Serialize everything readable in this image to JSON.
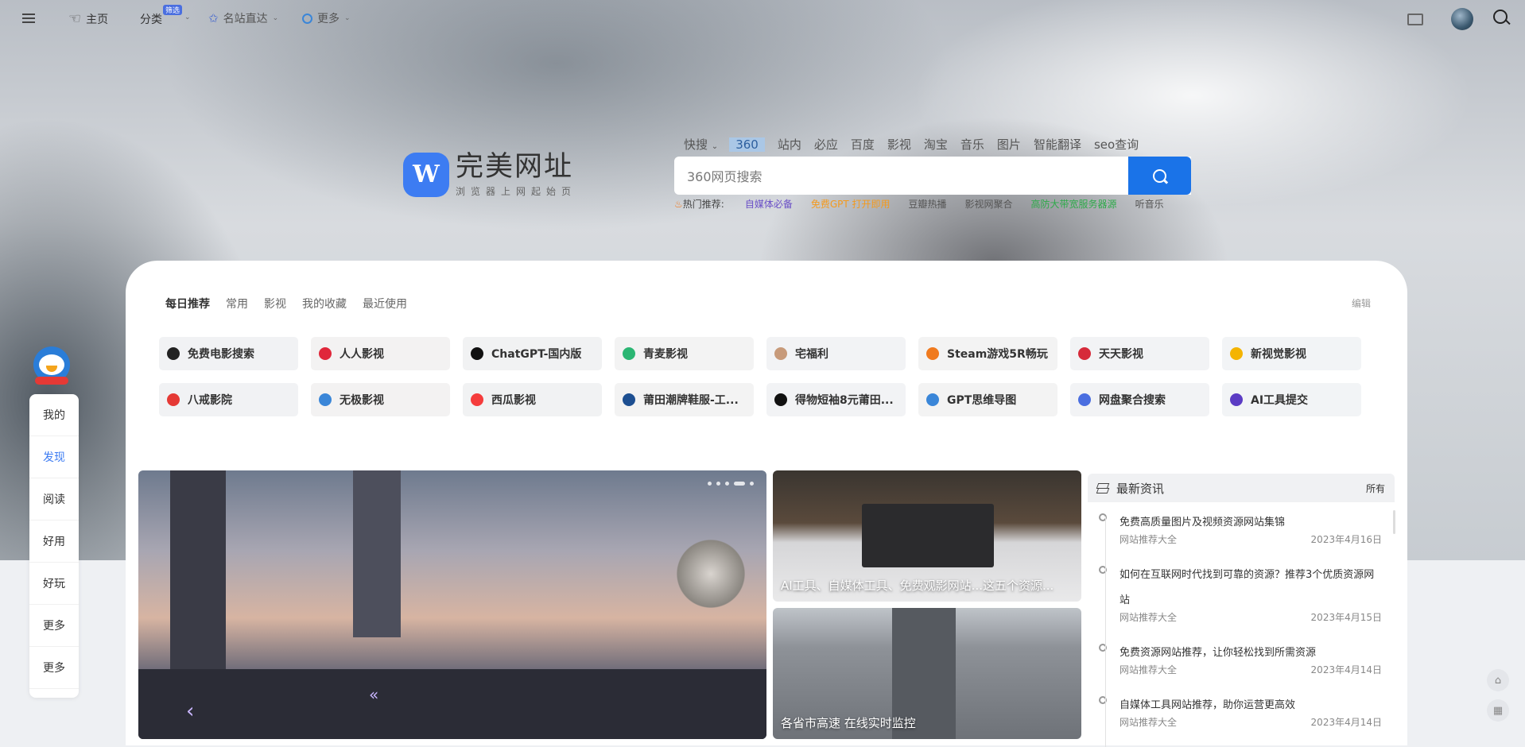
{
  "nav": {
    "home": "主页",
    "category": "分类",
    "category_badge": "筛选",
    "famous": "名站直达",
    "more": "更多"
  },
  "logo": {
    "title": "完美网址",
    "subtitle": "浏览器上网起始页",
    "mark": "W"
  },
  "search": {
    "tabs": [
      "快搜",
      "360",
      "站内",
      "必应",
      "百度",
      "影视",
      "淘宝",
      "音乐",
      "图片",
      "智能翻译",
      "seo查询"
    ],
    "active_tab": "360",
    "placeholder": "360网页搜索",
    "hot_label": "热门推荐:",
    "hot": [
      {
        "label": "自媒体必备",
        "color": "#6a4fc7"
      },
      {
        "label": "免费GPT 打开即用",
        "color": "#f39a1e"
      },
      {
        "label": "豆瓣热播",
        "color": "#555555"
      },
      {
        "label": "影视网聚合",
        "color": "#555555"
      },
      {
        "label": "高防大带宽服务器源",
        "color": "#2eaa4a"
      },
      {
        "label": "听音乐",
        "color": "#555555"
      }
    ]
  },
  "panel": {
    "tabs": [
      "每日推荐",
      "常用",
      "影视",
      "我的收藏",
      "最近使用"
    ],
    "edit": "编辑",
    "sites": [
      {
        "label": "免费电影搜索",
        "icon": "film-icon",
        "color": "#222222"
      },
      {
        "label": "人人影视",
        "icon": "k-icon",
        "color": "#e0273a"
      },
      {
        "label": "ChatGPT-国内版",
        "icon": "openai-icon",
        "color": "#111111"
      },
      {
        "label": "青麦影视",
        "icon": "leaf-icon",
        "color": "#2bb673"
      },
      {
        "label": "宅福利",
        "icon": "face-icon",
        "color": "#c79a7a"
      },
      {
        "label": "Steam游戏5R畅玩",
        "icon": "pacman-icon",
        "color": "#f07a1e"
      },
      {
        "label": "天天影视",
        "icon": "bow-icon",
        "color": "#d62a3a"
      },
      {
        "label": "新视觉影视",
        "icon": "orange-icon",
        "color": "#f4b400"
      },
      {
        "label": "八戒影院",
        "icon": "circle-icon",
        "color": "#e53935"
      },
      {
        "label": "无极影视",
        "icon": "swirl-icon",
        "color": "#3a86d8"
      },
      {
        "label": "西瓜影视",
        "icon": "play-icon",
        "color": "#f53c3c"
      },
      {
        "label": "莆田潮牌鞋服-工...",
        "icon": "shoe-icon",
        "color": "#1d4f91"
      },
      {
        "label": "得物短袖8元莆田...",
        "icon": "dewu-icon",
        "color": "#111111"
      },
      {
        "label": "GPT思维导图",
        "icon": "mindmap-icon",
        "color": "#3a86d8"
      },
      {
        "label": "网盘聚合搜索",
        "icon": "search-circle-icon",
        "color": "#4a6ee0"
      },
      {
        "label": "AI工具提交",
        "icon": "ai-icon",
        "color": "#5b3cc4"
      }
    ]
  },
  "sidebar": [
    "我的",
    "发现",
    "阅读",
    "好用",
    "好玩",
    "更多",
    "更多"
  ],
  "sidebar_active": "发现",
  "banners": {
    "card1_caption": "AI工具、自媒体工具、免费观影网站...这五个资源...",
    "card2_caption": "各省市高速 在线实时监控"
  },
  "news": {
    "title": "最新资讯",
    "all": "所有",
    "items": [
      {
        "title": "免费高质量图片及视频资源网站集锦",
        "source": "网站推荐大全",
        "date": "2023年4月16日"
      },
      {
        "title": "如何在互联网时代找到可靠的资源？推荐3个优质资源网站",
        "source": "网站推荐大全",
        "date": "2023年4月15日"
      },
      {
        "title": "免费资源网站推荐，让你轻松找到所需资源",
        "source": "网站推荐大全",
        "date": "2023年4月14日"
      },
      {
        "title": "自媒体工具网站推荐，助你运营更高效",
        "source": "网站推荐大全",
        "date": "2023年4月14日"
      }
    ]
  }
}
